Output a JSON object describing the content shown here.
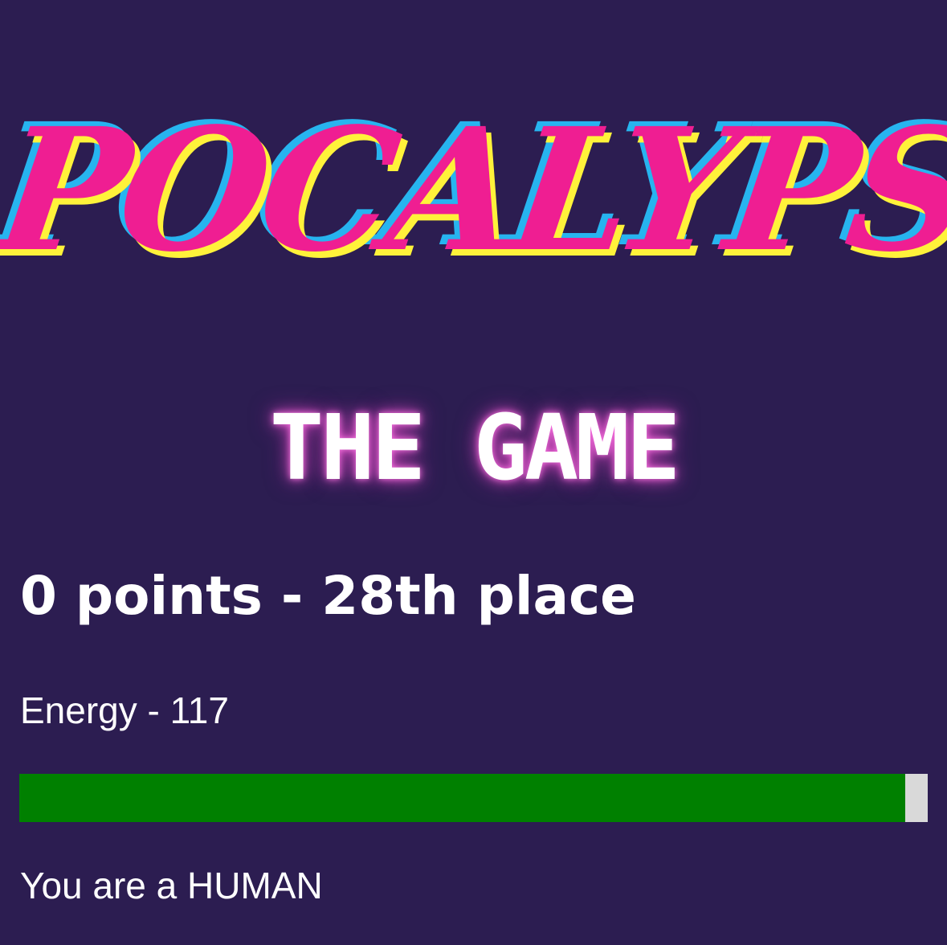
{
  "logo": {
    "text": "APOCALYPSE",
    "colors": {
      "primary": "#ef1e92",
      "shadow_blue": "#27b4ef",
      "shadow_yellow": "#fff23a"
    }
  },
  "subtitle": "THE GAME",
  "status": {
    "score_line": "0 points - 28th place",
    "energy_label": "Energy - 117",
    "energy_fraction": 0.975,
    "role_line": "You are a HUMAN"
  },
  "colors": {
    "background": "#2c1d51",
    "energy_fill": "#008000",
    "energy_track": "#d9d9d9",
    "glow": "#ff78e6"
  }
}
